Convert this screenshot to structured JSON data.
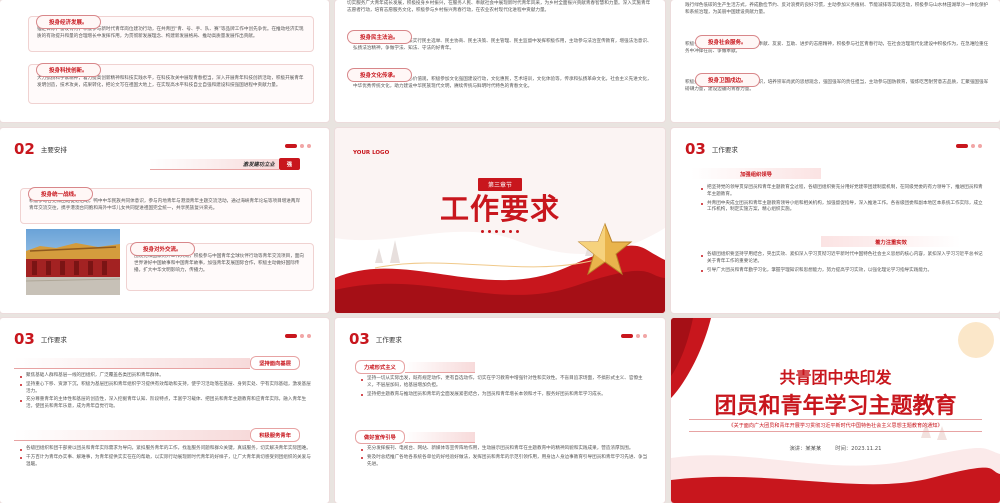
{
  "row1": {
    "slide1": {
      "top_text": "",
      "pill1": "投身经济发展。",
      "para1": "锚定目标，奋发有为，积极参与新时代青年岗位建功行动，在共青团“青、号、手、队、赛”等品牌工作中创先争优。在推动经济实现质的有效提升和量的合理增长中发挥作用，为贯彻新发展理念、构建新发展格局、推动高质量发展作出贡献。",
      "pill2": "投身科技创新。",
      "para2": "大力弘扬科学家精神，着力提高创新精神和科技实践水平，在科技攻关中展现青春担当，深入开展青年科技创新活动，积极开展青年发明创造，技术攻关，成果转化，把论文写在祖国大地上，在实现高水平科技自立自强和建设科技强国进程中贡献力量。"
    },
    "slide2": {
      "para_top": "切实服务广大青年成长发展，积极投身乡村振兴，在服务人民、奉献社会中展现新时代青年风采，为乡村全面振兴贡献青春智慧和力量。深入实施青年志愿者行动，培育志愿服务文化，积极参与乡村振兴青春行动，在农业农村现代化进程中贡献力量。",
      "pill_mid": "投身民主法治。",
      "para_mid": "参与全过程人民民主，在依法实行民主选举、民主协商、民主决策、民主管理、民主监督中发挥积极作用，主动参与法治宣传教育，增强法治意识、弘扬法治精神，争做学法、知法、守法的好青年。",
      "pill_bot": "投身文化传承。",
      "para_bot": "广泛弘扬和践行社会主义核心价值观，积极参加文化强国建设行动，文化惠民，艺术培训，文化体验等，传承和弘扬革命文化，社会主义先进文化，中华优秀传统文化，助力建设中华民族现代文明，赓续传统与鲜明时代特色的青春文化。"
    },
    "slide3": {
      "para_top": "践行绿色低碳的生产生活方式，养成勤俭节约、反对浪费的良好习惯，主动参加义务植树、节能减排等实践活动，积极参与山水林田湖草沙一体化保护和系统治理，为美丽中国建设贡献力量。",
      "pill1": "投身社会服务。",
      "para1": "积极参与青年志愿者行动，大力弘扬奉献、友爱、互助、进步的志愿精神，积极参与社区青春行动，在社会治理现代化建设中积极作为，在急难险重任务中冲锋在前、争做奉献。",
      "pill2": "投身卫国戍边。",
      "para2": "积极报名参军入伍，牢固树立国防意识，培养崇军尚武的思想观念，强固强军的责任担当，主动参与国防教育，锻炼吃苦耐劳意志品质，汇聚强国强军磅礴力量，建设边疆的青春力量。"
    }
  },
  "row2": {
    "slide4": {
      "num": "02",
      "title": "主要安排",
      "tag": "激发建功立业",
      "tag_sub": "强",
      "pill1": "投身统一战线。",
      "para1": "积极参与各党派团结促进活动，鸭中中华民族共同体意识，参与内地青年与港澳青年主题交流活动，通过海峡青年论坛等项目增进两岸青年交流交往，携手港澳台同胞和海外中华儿女共同促进祖国完全统一，共享民族复兴荣光。",
      "pill2": "投身对外交流。",
      "para2": "围绕党和国家对外工作大局，积极参与中国青年全球伙伴行动等青年交流项目，面向世界讲好中国故事和中国青年故事，加强青年友展国际合作，积极主动做好国际传播，扩大中华文明影响力，传播力。"
    },
    "slide5": {
      "logo": "YOUR LOGO",
      "badge": "第三章节",
      "title": "工作要求"
    },
    "slide6": {
      "num": "03",
      "title": "工作要求",
      "label1": "加强组织领导",
      "b1": [
        "把坚持党的领导贯穿团员和青年主题教育全过程，各级团组织要充分用好党建带团建制度机制，在同级党委的有力领导下，推进团员和青年主题教育。",
        "共青团中央成立团员和青年主题教育领导小组和相关机构，加强督促指导，深入推进工作。各省级团委和副本地区本系统工作实际，成立工作机构，制定实施方案，精心组织实施。"
      ],
      "label2": "着力注重实效",
      "b2": [
        "各级团组织要坚持学用结合，突出实效、紧扣深入学习贯彻习近平新时代中国特色社会主义思想的核心内容，紧扣深入学习习近平总书记关于青年工作的重要论述。",
        "引导广大团员和青年勤学习化，掌握学理知识和思想能力，努力提高学习实效，以强化理论学习指导实践能力。"
      ]
    }
  },
  "row3": {
    "slide7": {
      "num": "03",
      "title": "工作要求",
      "label1": "坚持面向基层",
      "b1": [
        "聚焦基础人群和基层一线的团组织，广泛覆盖各类团员和青年群体。",
        "坚持重心下移、资源下沉，积极为基层团员和青年组织学习提供有效帮助和支持，使学习活动落在基层、身到实处、学有实际基础，激发基层活力。",
        "充分尊重青年的主体性和基层的创造性，深入挖掘青年认知、阶段特点，丰富学习载体、把团员和青年主题教育和应青年实际，融入青年生活，使团员和青年乐意，成为青年自觉行动。"
      ],
      "label2": "积极服务青年",
      "b2": [
        "各级团组织和团干部要以团员和青年实际需求为导向，紧扣服务青年的工作，找准服务问题和群众关键，真诚服务，切实解决青年实际困难。",
        "千方百计为青年办实事、解难事，为青年提供实实在在的帮助，以实际行动展现新时代青年的好样子，让广大青年真切感受到团组织的关爱与温暖。"
      ]
    },
    "slide8": {
      "num": "03",
      "title": "工作要求",
      "label1": "力戒形式主义",
      "b1": [
        "坚持一切从实际出发，既有规定动作，更有自选动作，切实在学习教育中增强针对性和实效性。不盲目追求场面，不搞形式主义、官僚主义，不层层加码，给基层增加负担。",
        "坚持把主题教育与推动团员和青年的全面发展紧密结合，为团员和青年增长本领和才干，服务好团员和青年学习成长。"
      ],
      "label2": "做好宣传引导",
      "b2": [
        "充分发挥报刊、电视台、网站、新媒体等宣传阵地作用，生动展示团员和青年在主题教育中的精神风貌和实践成果，营造浓厚氛围。",
        "要及时总结推广各地各系统各单位的好经验好做法，发挥团员和青年的示范引领作用，用身边人身边事教育引导团员和青年学习先进、争当先进。"
      ]
    },
    "slide9": {
      "title1": "共青团中央印发",
      "title2": "团员和青年学习主题教育",
      "subtitle": "《关于面向广大团员和青年开展学习贯彻习近平新时代中国特色社会主义思想主题教育的通知》",
      "speaker": "演讲：某某某",
      "time": "时间：2023.11.21"
    }
  },
  "colors": {
    "accent": "#c8161d",
    "soft": "#f7dada",
    "gold": "#e9b44c"
  }
}
